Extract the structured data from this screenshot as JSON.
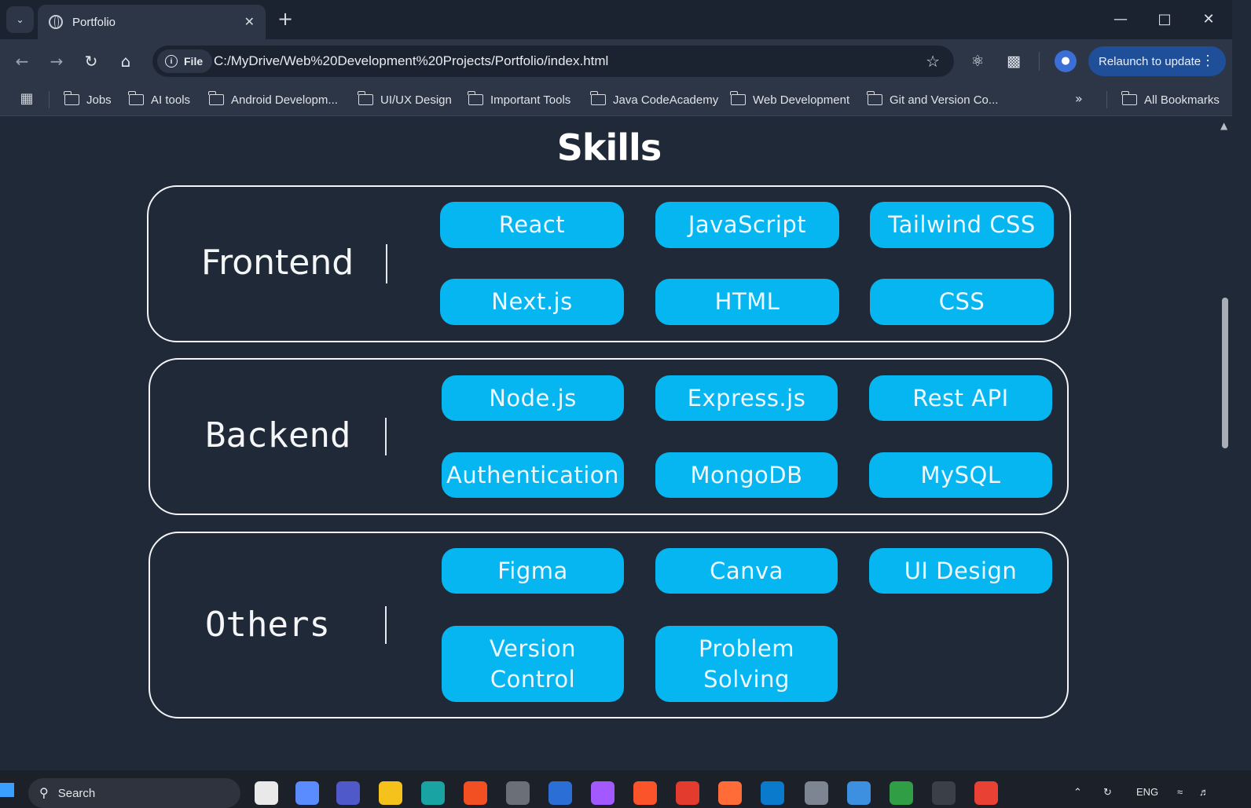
{
  "browser": {
    "tab_title": "Portfolio",
    "url_chip": "File",
    "url": "C:/MyDrive/Web%20Development%20Projects/Portfolio/index.html",
    "relaunch_label": "Relaunch to update",
    "bookmarks": [
      "Jobs",
      "AI tools",
      "Android Developm...",
      "UI/UX Design",
      "Important Tools",
      "Java CodeAcademy",
      "Web Development",
      "Git and Version Co..."
    ],
    "all_bookmarks": "All Bookmarks"
  },
  "page": {
    "title": "Skills",
    "categories": [
      {
        "name": "Frontend",
        "skills": [
          "React",
          "JavaScript",
          "Tailwind CSS",
          "Next.js",
          "HTML",
          "CSS"
        ]
      },
      {
        "name": "Backend",
        "skills": [
          "Node.js",
          "Express.js",
          "Rest API",
          "Authentication",
          "MongoDB",
          "MySQL"
        ]
      },
      {
        "name": "Others",
        "skills": [
          "Figma",
          "Canva",
          "UI Design",
          "Version Control",
          "Problem Solving"
        ]
      }
    ]
  },
  "taskbar": {
    "search_label": "Search",
    "lang": "ENG"
  },
  "colors": {
    "pill": "#05b6f0",
    "background": "#1f2937",
    "relaunch": "#1f4f99"
  }
}
